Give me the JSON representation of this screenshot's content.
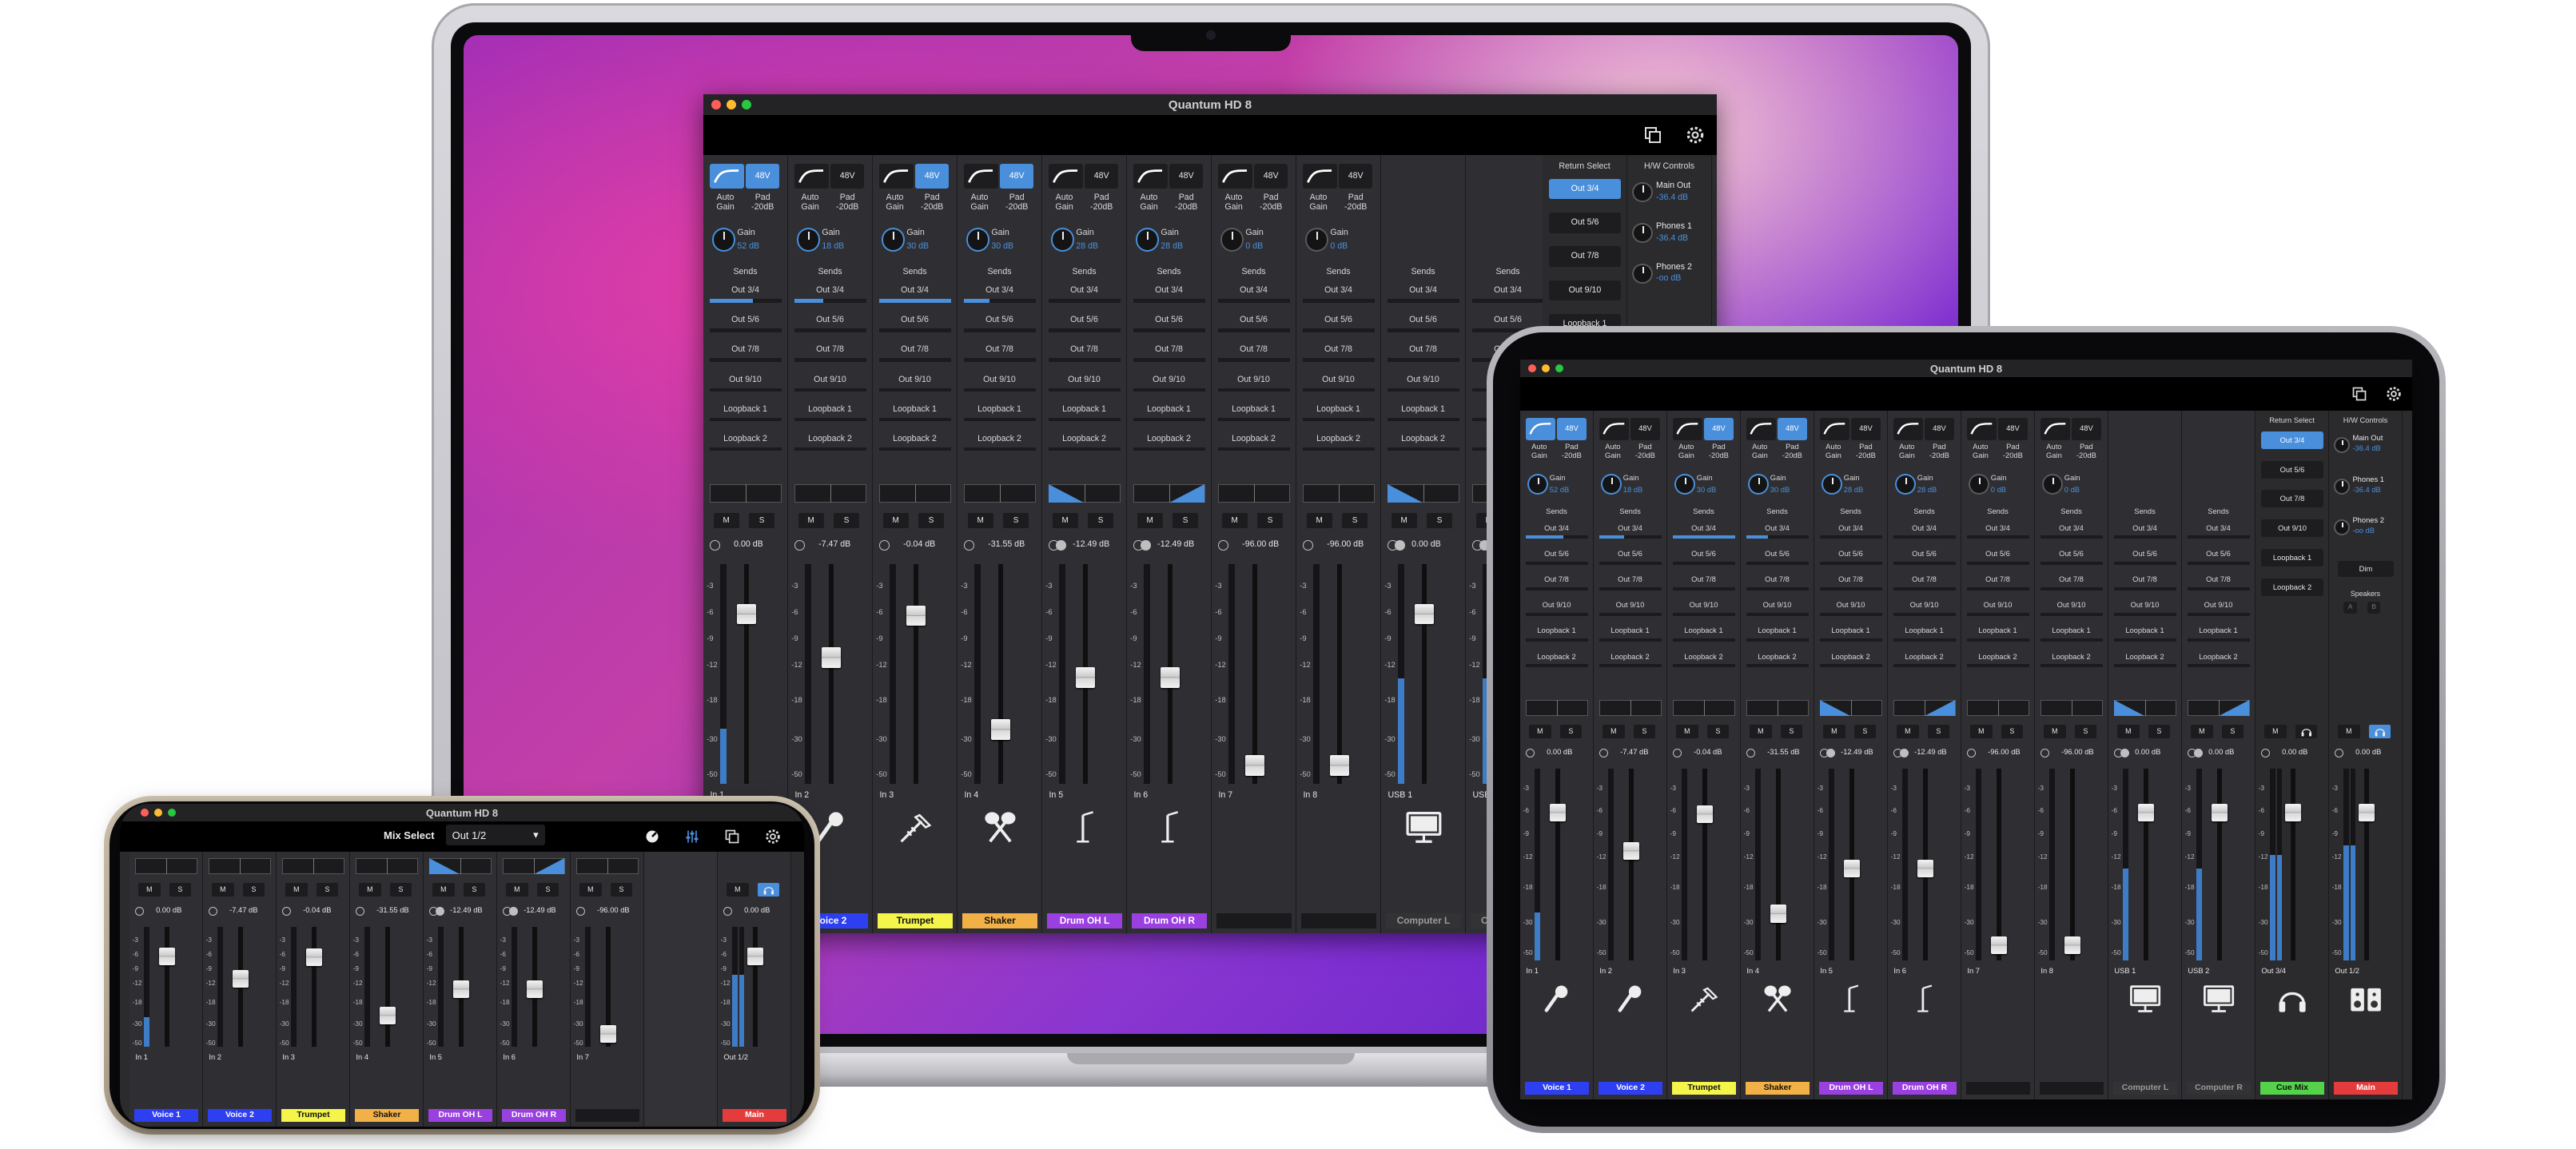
{
  "app": {
    "title": "Quantum HD 8",
    "return_select_label": "Return Select",
    "hw_controls_label": "H/W Controls",
    "mix_select_label": "Mix Select",
    "mix_select_value": "Out 1/2",
    "toolbar_icons": [
      "copy-icon",
      "settings-gear-icon"
    ]
  },
  "strip_text": {
    "hpf_icon": "high-pass-filter-icon",
    "phantom": "48V",
    "auto": "Auto",
    "gain_word": "Gain",
    "pad": "Pad",
    "pad_val": "-20dB",
    "gain_label": "Gain",
    "sends_label": "Sends",
    "mute": "M",
    "solo": "S",
    "headphone_icon": "headphones-icon"
  },
  "sends": [
    "Out 3/4",
    "Out 5/6",
    "Out 7/8",
    "Out 9/10",
    "Loopback 1",
    "Loopback 2"
  ],
  "fader_scale": [
    "-3",
    "-6",
    "-9",
    "-12",
    "-18",
    "-30",
    "-50"
  ],
  "channels": [
    {
      "input": "In 1",
      "name": "Voice 1",
      "color": "#2e3ff2",
      "text_color": "#ffffff",
      "gain_value": "52 dB",
      "level": "0.00 dB",
      "phantom_on": true,
      "hpf_on": true,
      "icon": "microphone-icon",
      "fader": 0.8,
      "meter": 0.25,
      "send": 0.6,
      "pan": "center",
      "link": false
    },
    {
      "input": "In 2",
      "name": "Voice 2",
      "color": "#2e3ff2",
      "text_color": "#ffffff",
      "gain_value": "18 dB",
      "level": "-7.47 dB",
      "phantom_on": false,
      "hpf_on": false,
      "icon": "microphone-icon",
      "fader": 0.58,
      "meter": 0.0,
      "send": 0.4,
      "pan": "center",
      "link": false
    },
    {
      "input": "In 3",
      "name": "Trumpet",
      "color": "#f4f44a",
      "text_color": "#111111",
      "gain_value": "30 dB",
      "level": "-0.04 dB",
      "phantom_on": true,
      "hpf_on": false,
      "icon": "trumpet-icon",
      "fader": 0.79,
      "meter": 0.0,
      "send": 1.0,
      "pan": "center",
      "link": false
    },
    {
      "input": "In 4",
      "name": "Shaker",
      "color": "#f2b146",
      "text_color": "#111111",
      "gain_value": "30 dB",
      "level": "-31.55 dB",
      "phantom_on": true,
      "hpf_on": false,
      "icon": "maracas-icon",
      "fader": 0.22,
      "meter": 0.0,
      "send": 0.35,
      "pan": "center",
      "link": false
    },
    {
      "input": "In 5",
      "name": "Drum OH L",
      "color": "#9a3fe0",
      "text_color": "#ffffff",
      "gain_value": "28 dB",
      "level": "-12.49 dB",
      "phantom_on": false,
      "hpf_on": false,
      "icon": "drumstick-icon",
      "fader": 0.48,
      "meter": 0.0,
      "send": 0.0,
      "pan": "left",
      "link": true
    },
    {
      "input": "In 6",
      "name": "Drum OH R",
      "color": "#9a3fe0",
      "text_color": "#ffffff",
      "gain_value": "28 dB",
      "level": "-12.49 dB",
      "phantom_on": false,
      "hpf_on": false,
      "icon": "drumstick-icon",
      "fader": 0.48,
      "meter": 0.0,
      "send": 0.0,
      "pan": "right",
      "link": true
    },
    {
      "input": "In 7",
      "name": "",
      "color": "#1a1a1c",
      "text_color": "#ffffff",
      "gain_value": "0 dB",
      "level": "-96.00 dB",
      "phantom_on": false,
      "hpf_on": false,
      "icon": "",
      "fader": 0.04,
      "meter": 0.0,
      "send": 0.0,
      "pan": "center",
      "link": false
    },
    {
      "input": "In 8",
      "name": "",
      "color": "#1a1a1c",
      "text_color": "#ffffff",
      "gain_value": "0 dB",
      "level": "-96.00 dB",
      "phantom_on": false,
      "hpf_on": false,
      "icon": "",
      "fader": 0.04,
      "meter": 0.0,
      "send": 0.0,
      "pan": "center",
      "link": false
    },
    {
      "input": "USB 1",
      "name": "Computer L",
      "color": "#333336",
      "text_color": "#9a9a9a",
      "gain_value": "",
      "level": "0.00 dB",
      "phantom_on": false,
      "hpf_on": false,
      "icon": "monitor-icon",
      "fader": 0.8,
      "meter": 0.48,
      "send": 0.0,
      "pan": "left",
      "link": true
    },
    {
      "input": "USB 2",
      "name": "Computer R",
      "color": "#333336",
      "text_color": "#9a9a9a",
      "gain_value": "",
      "level": "0.00 dB",
      "phantom_on": false,
      "hpf_on": false,
      "icon": "monitor-icon",
      "fader": 0.8,
      "meter": 0.48,
      "send": 0.0,
      "pan": "right",
      "link": true
    }
  ],
  "returns": [
    {
      "label": "Out 3/4",
      "active": true
    },
    {
      "label": "Out 5/6",
      "active": false
    },
    {
      "label": "Out 7/8",
      "active": false
    },
    {
      "label": "Out 9/10",
      "active": false
    },
    {
      "label": "Loopback 1",
      "active": false
    },
    {
      "label": "Loopback 2",
      "active": false
    }
  ],
  "hw_controls": [
    {
      "name": "Main Out",
      "value": "-36.4 dB"
    },
    {
      "name": "Phones 1",
      "value": "-36.4 dB"
    },
    {
      "name": "Phones 2",
      "value": "-oo dB"
    }
  ],
  "hw_extra": {
    "dim": "Dim",
    "speakers": "Speakers",
    "spk_a": "A",
    "spk_b": "B"
  },
  "outputs": [
    {
      "input": "Out 3/4",
      "name": "Cue Mix",
      "color": "#53d24a",
      "text_color": "#111111",
      "level": "0.00 dB",
      "icon": "headphones-icon",
      "fader": 0.8,
      "meter": 0.55
    },
    {
      "input": "Out 1/2",
      "name": "Main",
      "color": "#e43c3c",
      "text_color": "#ffffff",
      "level": "0.00 dB",
      "icon": "speakers-icon",
      "fader": 0.8,
      "meter": 0.6
    }
  ]
}
